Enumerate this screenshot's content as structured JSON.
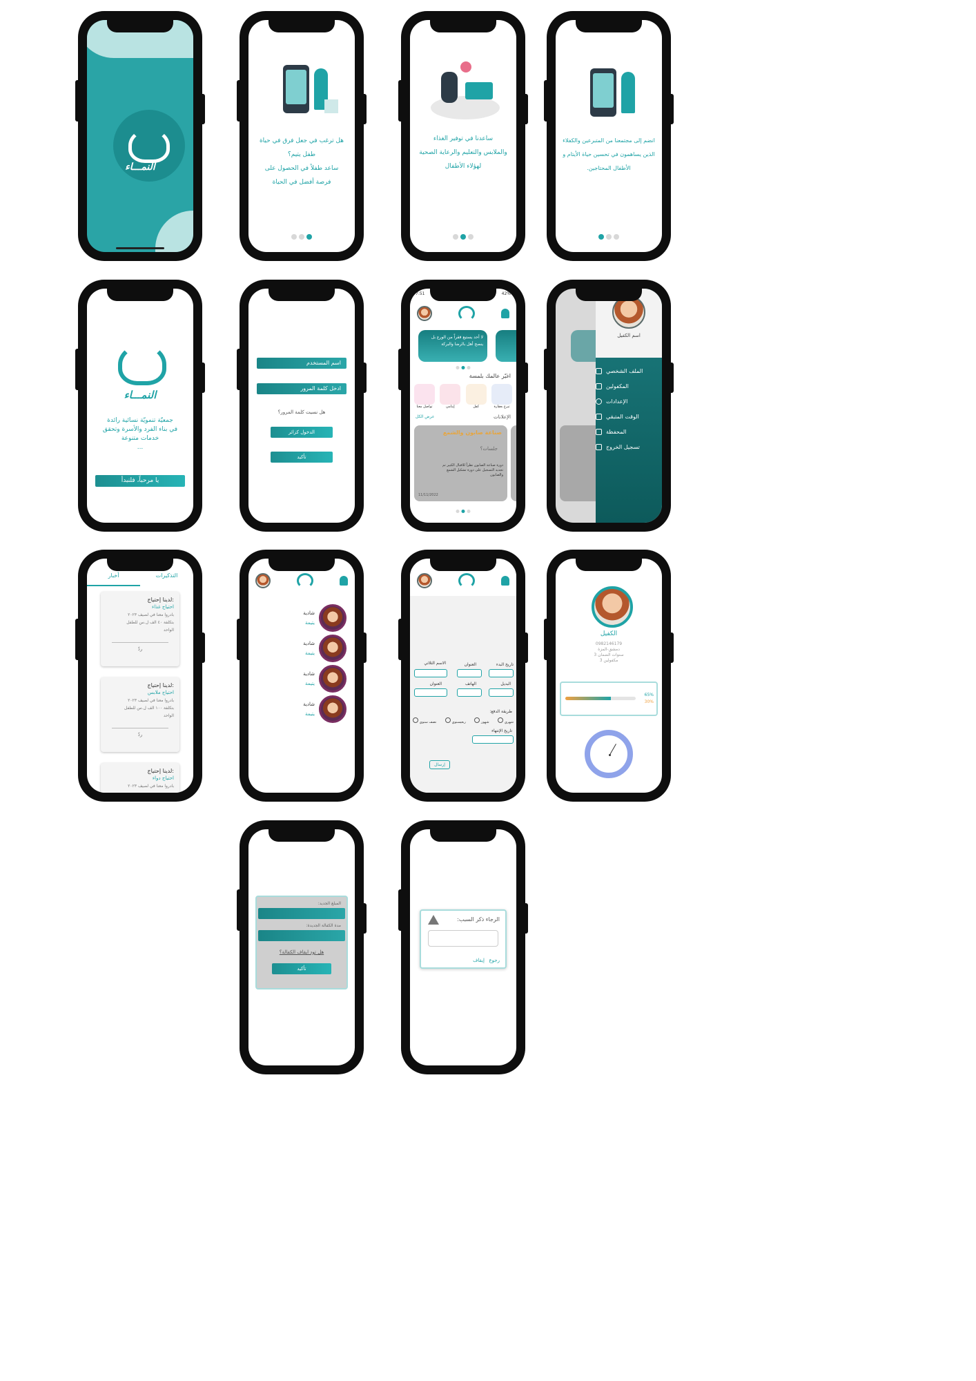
{
  "brand": {
    "name": "النمـــاء",
    "color": "#1fa3a6"
  },
  "onboarding": [
    {
      "text": [
        "هل ترغب في جعل فرق في حياة طفل يتيم؟",
        "ساعد طفلاً في الحصول على",
        "فرصة أفضل في الحياة"
      ],
      "active_dot": 0
    },
    {
      "text": [
        "ساعدنا في توفير الغذاء",
        "والملابس والتعليم والرعاية الصحية",
        "لهؤلاء الأطفال"
      ],
      "active_dot": 1
    },
    {
      "text": [
        "انضم إلى مجتمعنا من المتبرعين والكفلاء",
        "الذين يساهمون في تحسين حياة الأيتام و",
        "الأطفال المحتاجين."
      ],
      "active_dot": 2
    }
  ],
  "welcome": {
    "tagline": [
      "جمعيّة تنمويّة نسائية رائدة",
      "في بناء الفرد والأسرة وتحقق",
      "خدمات متنوعة",
      "..."
    ],
    "button": "يا مرحباً، فلنبدأ"
  },
  "login": {
    "username": "اسم المستخدم",
    "password": "ادخل كلمة المرور",
    "forgot": "هل نسيت كلمة المرور؟",
    "guest": "الدخول كزائر",
    "confirm": "تأكيد"
  },
  "home": {
    "status_time": "7:51",
    "status_battery": "42%",
    "banner_text": "لا أحد يستيع فقراً من الورع بل ينصح أهل بالرضا والبركة",
    "section_title": "اغيّر عالمك بلمسة",
    "services": [
      "تبرع بعقارة",
      "كفل",
      "إيتامي",
      "تواصل معنا"
    ],
    "ads_title": "الإعلانات",
    "see_all": "عرض الكل",
    "ad_date": "11/11/2022",
    "ad_title": "صناعة صابون والشمع",
    "ad_body": "دورة صناعة الصابون نظراً للاقبال الكبير تم تجديد التسجيل على دورة تشكيل الشمع والصابون",
    "ad_tag": "جلسات؟"
  },
  "drawer": {
    "name": "اسم الكفيل",
    "items": [
      "الملف الشخصي",
      "المكفولين",
      "الإعدادات",
      "الوقت المتبقي",
      "المحفظة",
      "تسجيل الخروج"
    ]
  },
  "needs": {
    "tabs": [
      "التذكيرات",
      "أخبار"
    ],
    "cards": [
      {
        "title": ":لدينا إحتياج",
        "type": "احتياج غذاء",
        "lines": [
          "بادروا معنا في لصيف ٢٠٢٣",
          "بتكلفة ٤٠ الف ل.س للطفل",
          "الواحد"
        ],
        "reply": "ردّ"
      },
      {
        "title": ":لدينا إحتياج",
        "type": "احتياج ملابس",
        "lines": [
          "بادروا معنا في لصيف ٢٠٢٣",
          "بتكلفة ١٠٠ الف ل.س للطفل",
          "الواحد"
        ],
        "reply": "ردّ"
      },
      {
        "title": ":لدينا إحتياج",
        "type": "احتياج دواء",
        "lines": [
          "بادروا معنا في لصيف ٢٠٢٣"
        ],
        "reply": ""
      }
    ]
  },
  "orphans": {
    "items": [
      {
        "name": "شادية",
        "tag": "يتيمة"
      },
      {
        "name": "شادية",
        "tag": "يتيمة"
      },
      {
        "name": "شادية",
        "tag": "يتيمة"
      },
      {
        "name": "شادية",
        "tag": "يتيمة"
      }
    ]
  },
  "form": {
    "labels": [
      "تاريخ البدء",
      "العنوان",
      "الاسم الثلاثي",
      "البديل",
      "الهاتف",
      "العنوان"
    ],
    "payment_label": "طريقة الدفع:",
    "payment_options": [
      "شهري",
      "شهور",
      "ربعيسنوي",
      "نصف سنوي"
    ],
    "end_label": "تاريخ الإنتهاء",
    "submit": "إرسال"
  },
  "profile": {
    "title": "الكفيل",
    "phone": "0982146179",
    "lines": [
      "دمشق-المزة",
      "سنوات الضمان 3",
      "مكفولين 3"
    ],
    "progress_top": "65%",
    "progress_bottom": "30%",
    "progress_value": 0.65
  },
  "renew": {
    "amount_label": "المبلغ الجديد:",
    "duration_label": "مدة الكفالة الجديدة:",
    "stop_link": "هل تود ايقاف الكفالة؟",
    "confirm": "تأكيد"
  },
  "reason": {
    "title": "الرجاء ذكر السبب:",
    "back": "رجوع",
    "stop": "إيقاف"
  }
}
